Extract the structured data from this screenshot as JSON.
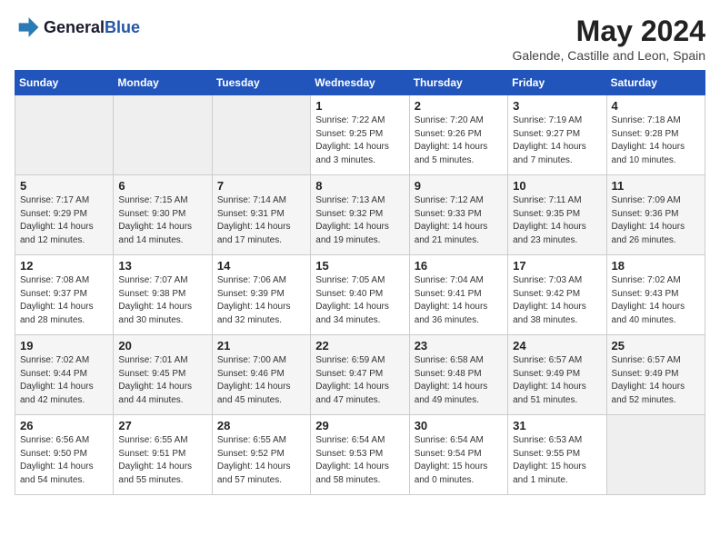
{
  "header": {
    "logo_general": "General",
    "logo_blue": "Blue",
    "month_year": "May 2024",
    "location": "Galende, Castille and Leon, Spain"
  },
  "weekdays": [
    "Sunday",
    "Monday",
    "Tuesday",
    "Wednesday",
    "Thursday",
    "Friday",
    "Saturday"
  ],
  "weeks": [
    [
      {
        "day": "",
        "info": ""
      },
      {
        "day": "",
        "info": ""
      },
      {
        "day": "",
        "info": ""
      },
      {
        "day": "1",
        "info": "Sunrise: 7:22 AM\nSunset: 9:25 PM\nDaylight: 14 hours and 3 minutes."
      },
      {
        "day": "2",
        "info": "Sunrise: 7:20 AM\nSunset: 9:26 PM\nDaylight: 14 hours and 5 minutes."
      },
      {
        "day": "3",
        "info": "Sunrise: 7:19 AM\nSunset: 9:27 PM\nDaylight: 14 hours and 7 minutes."
      },
      {
        "day": "4",
        "info": "Sunrise: 7:18 AM\nSunset: 9:28 PM\nDaylight: 14 hours and 10 minutes."
      }
    ],
    [
      {
        "day": "5",
        "info": "Sunrise: 7:17 AM\nSunset: 9:29 PM\nDaylight: 14 hours and 12 minutes."
      },
      {
        "day": "6",
        "info": "Sunrise: 7:15 AM\nSunset: 9:30 PM\nDaylight: 14 hours and 14 minutes."
      },
      {
        "day": "7",
        "info": "Sunrise: 7:14 AM\nSunset: 9:31 PM\nDaylight: 14 hours and 17 minutes."
      },
      {
        "day": "8",
        "info": "Sunrise: 7:13 AM\nSunset: 9:32 PM\nDaylight: 14 hours and 19 minutes."
      },
      {
        "day": "9",
        "info": "Sunrise: 7:12 AM\nSunset: 9:33 PM\nDaylight: 14 hours and 21 minutes."
      },
      {
        "day": "10",
        "info": "Sunrise: 7:11 AM\nSunset: 9:35 PM\nDaylight: 14 hours and 23 minutes."
      },
      {
        "day": "11",
        "info": "Sunrise: 7:09 AM\nSunset: 9:36 PM\nDaylight: 14 hours and 26 minutes."
      }
    ],
    [
      {
        "day": "12",
        "info": "Sunrise: 7:08 AM\nSunset: 9:37 PM\nDaylight: 14 hours and 28 minutes."
      },
      {
        "day": "13",
        "info": "Sunrise: 7:07 AM\nSunset: 9:38 PM\nDaylight: 14 hours and 30 minutes."
      },
      {
        "day": "14",
        "info": "Sunrise: 7:06 AM\nSunset: 9:39 PM\nDaylight: 14 hours and 32 minutes."
      },
      {
        "day": "15",
        "info": "Sunrise: 7:05 AM\nSunset: 9:40 PM\nDaylight: 14 hours and 34 minutes."
      },
      {
        "day": "16",
        "info": "Sunrise: 7:04 AM\nSunset: 9:41 PM\nDaylight: 14 hours and 36 minutes."
      },
      {
        "day": "17",
        "info": "Sunrise: 7:03 AM\nSunset: 9:42 PM\nDaylight: 14 hours and 38 minutes."
      },
      {
        "day": "18",
        "info": "Sunrise: 7:02 AM\nSunset: 9:43 PM\nDaylight: 14 hours and 40 minutes."
      }
    ],
    [
      {
        "day": "19",
        "info": "Sunrise: 7:02 AM\nSunset: 9:44 PM\nDaylight: 14 hours and 42 minutes."
      },
      {
        "day": "20",
        "info": "Sunrise: 7:01 AM\nSunset: 9:45 PM\nDaylight: 14 hours and 44 minutes."
      },
      {
        "day": "21",
        "info": "Sunrise: 7:00 AM\nSunset: 9:46 PM\nDaylight: 14 hours and 45 minutes."
      },
      {
        "day": "22",
        "info": "Sunrise: 6:59 AM\nSunset: 9:47 PM\nDaylight: 14 hours and 47 minutes."
      },
      {
        "day": "23",
        "info": "Sunrise: 6:58 AM\nSunset: 9:48 PM\nDaylight: 14 hours and 49 minutes."
      },
      {
        "day": "24",
        "info": "Sunrise: 6:57 AM\nSunset: 9:49 PM\nDaylight: 14 hours and 51 minutes."
      },
      {
        "day": "25",
        "info": "Sunrise: 6:57 AM\nSunset: 9:49 PM\nDaylight: 14 hours and 52 minutes."
      }
    ],
    [
      {
        "day": "26",
        "info": "Sunrise: 6:56 AM\nSunset: 9:50 PM\nDaylight: 14 hours and 54 minutes."
      },
      {
        "day": "27",
        "info": "Sunrise: 6:55 AM\nSunset: 9:51 PM\nDaylight: 14 hours and 55 minutes."
      },
      {
        "day": "28",
        "info": "Sunrise: 6:55 AM\nSunset: 9:52 PM\nDaylight: 14 hours and 57 minutes."
      },
      {
        "day": "29",
        "info": "Sunrise: 6:54 AM\nSunset: 9:53 PM\nDaylight: 14 hours and 58 minutes."
      },
      {
        "day": "30",
        "info": "Sunrise: 6:54 AM\nSunset: 9:54 PM\nDaylight: 15 hours and 0 minutes."
      },
      {
        "day": "31",
        "info": "Sunrise: 6:53 AM\nSunset: 9:55 PM\nDaylight: 15 hours and 1 minute."
      },
      {
        "day": "",
        "info": ""
      }
    ]
  ]
}
